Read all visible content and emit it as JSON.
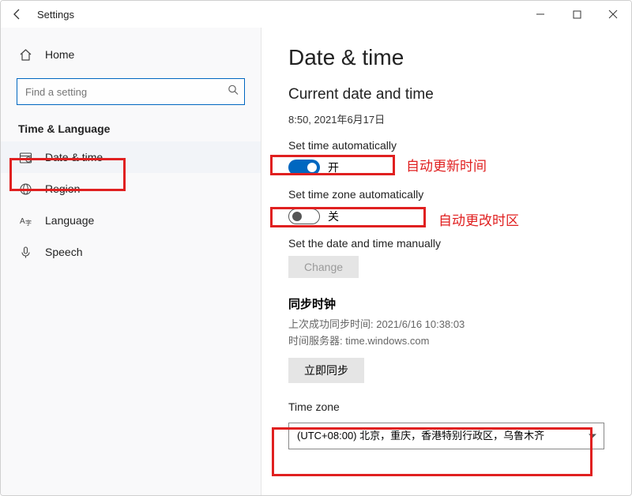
{
  "titlebar": {
    "title": "Settings"
  },
  "sidebar": {
    "home_label": "Home",
    "search_placeholder": "Find a setting",
    "section_title": "Time & Language",
    "items": [
      {
        "label": "Date & time"
      },
      {
        "label": "Region"
      },
      {
        "label": "Language"
      },
      {
        "label": "Speech"
      }
    ]
  },
  "content": {
    "heading": "Date & time",
    "current_label": "Current date and time",
    "current_value": "8:50, 2021年6月17日",
    "set_time_auto_label": "Set time automatically",
    "set_time_auto_state": "开",
    "set_tz_auto_label": "Set time zone automatically",
    "set_tz_auto_state": "关",
    "manual_label": "Set the date and time manually",
    "change_button": "Change",
    "sync_title": "同步时钟",
    "sync_last": "上次成功同步时间: 2021/6/16 10:38:03",
    "sync_server": "时间服务器: time.windows.com",
    "sync_now_button": "立即同步",
    "timezone_label": "Time zone",
    "timezone_value": "(UTC+08:00) 北京，重庆，香港特别行政区，乌鲁木齐"
  },
  "annotations": {
    "auto_time": "自动更新时间",
    "auto_tz": "自动更改时区"
  }
}
